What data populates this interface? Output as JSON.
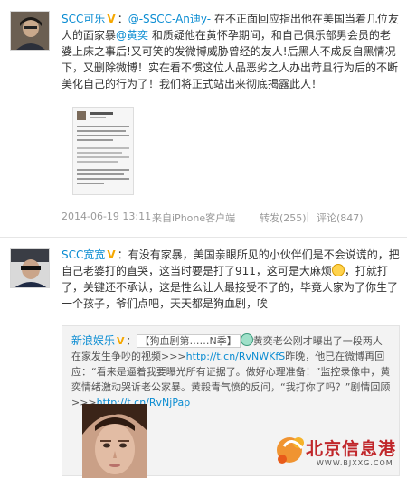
{
  "post1": {
    "author": "SCC可乐",
    "text_segments": [
      "：",
      "@-SSCC-An迪y-",
      " 在不正面回应指出他在美国当着几位友人的面家暴",
      "@黄奕",
      " 和质疑他在黄怀孕期间，和自己俱乐部男会员的老婆上床之事后!又可笑的发微博威胁曾经的友人!后黑人不成反自黑情况下，又删除微博！实在看不惯这位人品恶劣之人办出苛且行为后的不断美化自己的行为了！我们将正式站出来彻底揭露此人！"
    ],
    "timestamp": "2014-06-19 13:11",
    "source": "来自iPhone客户端",
    "repost": "转发(255)",
    "divider": "|",
    "comment": "评论(847)",
    "thumb_title": "SCC可乐"
  },
  "post2": {
    "author": "SCC宽宽",
    "text_a": "：有没有家暴，美国亲眼所见的小伙伴们是不会说谎的，把自己老婆打的直哭，这当时要是打了911，这可是大麻烦",
    "text_b": "，打就打了，关键还不承认，这是性么让人最接受不了的，毕竟人家为了你生了一个孩子，爷们点吧，天天都是狗血剧，唉",
    "retweet": {
      "author": "新浪娱乐",
      "tag": "【狗血剧第……N季】",
      "text_a": "黄奕老公刚才曝出了一段两人在家发生争吵的视频>>>",
      "link1": "http://t.cn/RvNWKfS",
      "text_b": "昨晚，他已在微博再回应：“看来是逼着我要曝光所有证据了。做好心理准备！”监控录像中，黄奕情绪激动哭诉老公家暴。黄毅青气愤的反问，“我打你了吗？”剧情回顾>>>",
      "link2": "http://t.cn/RvNjPap"
    }
  },
  "watermark": {
    "name": "北京信息港",
    "url": "WWW.BJXXG.COM"
  }
}
